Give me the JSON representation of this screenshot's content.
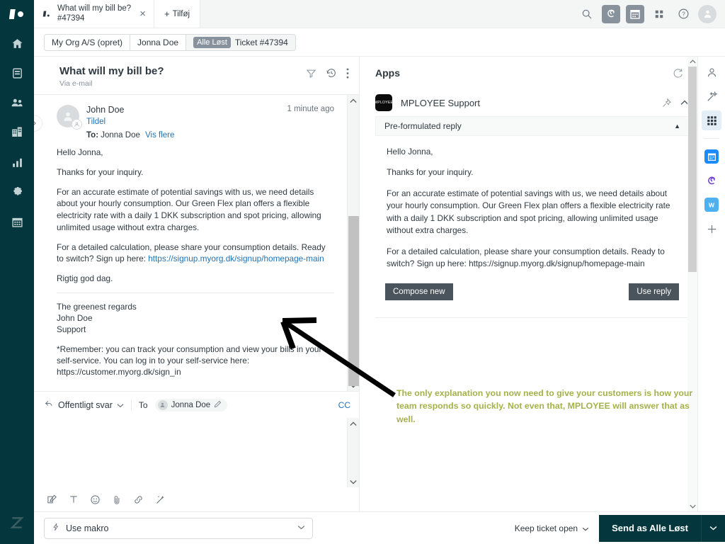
{
  "colors": {
    "brand_dark": "#03363d",
    "accent_link": "#1f73b7",
    "annotation": "#a5b14a",
    "badge_gray": "#87929d",
    "button_gray": "#49545c"
  },
  "leftnav": {
    "brand_icon": "zendesk-logo-icon",
    "items": [
      {
        "icon": "home-icon",
        "label": "Home"
      },
      {
        "icon": "views-icon",
        "label": "Views"
      },
      {
        "icon": "customers-icon",
        "label": "Customers"
      },
      {
        "icon": "organizations-icon",
        "label": "Organizations"
      },
      {
        "icon": "reporting-icon",
        "label": "Reporting"
      },
      {
        "icon": "admin-gear-icon",
        "label": "Admin"
      },
      {
        "icon": "calendar-icon",
        "label": "Calendar"
      }
    ],
    "bottom_logo": "zendesk-z-icon"
  },
  "topbar": {
    "tab": {
      "title": "What will my bill be?",
      "subtitle": "#47394",
      "close": "×",
      "icon": "ticket-icon"
    },
    "add_tab": {
      "plus": "+",
      "label": "Tilføj"
    },
    "icons": [
      {
        "name": "search-icon"
      },
      {
        "name": "spiral-app-icon"
      },
      {
        "name": "calendar-app-icon"
      },
      {
        "name": "products-grid-icon"
      },
      {
        "name": "help-icon"
      },
      {
        "name": "user-avatar-icon"
      }
    ]
  },
  "breadcrumb": {
    "items": [
      {
        "label": "My Org A/S (opret)",
        "badge": ""
      },
      {
        "label": "Jonna Doe",
        "badge": ""
      },
      {
        "label": "Ticket #47394",
        "badge": "Alle Løst"
      }
    ]
  },
  "ticket": {
    "title": "What will my bill be?",
    "via": "Via e-mail",
    "actions": [
      {
        "name": "filter-icon"
      },
      {
        "name": "history-icon"
      },
      {
        "name": "more-options-icon"
      }
    ],
    "message": {
      "author": "John Doe",
      "assign_link": "Tildel",
      "to_label": "To:",
      "to_value": "Jonna Doe",
      "show_more": "Vis flere",
      "timestamp": "1 minute ago",
      "greeting": "Hello Jonna,",
      "thanks": "Thanks for your inquiry.",
      "paragraph1": "For an accurate estimate of potential savings with us, we need details about your hourly consumption. Our Green Flex plan offers a flexible electricity rate with a daily 1 DKK subscription and spot pricing, allowing unlimited usage without extra charges.",
      "paragraph2_pre": "For a detailed calculation, please share your consumption details. Ready to switch? Sign up here: ",
      "paragraph2_link": "https://signup.myorg.dk/signup/homepage-main",
      "closing": "Rigtig god dag.",
      "sign_line1": "The greenest regards",
      "sign_line2": "John Doe",
      "sign_line3": "Support",
      "footnote": "*Remember: you can track your consumption and view your bills in your self-service. You can log in to your self-service here: https://customer.myorg.dk/sign_in"
    }
  },
  "composer": {
    "channel": "Offentligt svar",
    "to_label": "To",
    "recipient": "Jonna Doe",
    "cc_label": "CC",
    "tools": [
      {
        "name": "compose-icon"
      },
      {
        "name": "text-format-icon"
      },
      {
        "name": "emoji-icon"
      },
      {
        "name": "attachment-icon"
      },
      {
        "name": "link-icon"
      },
      {
        "name": "magic-wand-icon"
      }
    ]
  },
  "apps": {
    "title": "Apps",
    "refresh_icon": "refresh-icon",
    "card": {
      "icon_text": "MPLOYEE",
      "name": "MPLOYEE Support",
      "pin_icon": "pin-icon",
      "collapse_icon": "chevron-up-icon",
      "section_title": "Pre-formulated reply",
      "section_caret": "▲",
      "reply": {
        "greeting": "Hello Jonna,",
        "thanks": "Thanks for your inquiry.",
        "paragraph1": "For an accurate estimate of potential savings with us, we need details about your hourly consumption. Our Green Flex plan offers a flexible electricity rate with a daily 1 DKK subscription and spot pricing, allowing unlimited usage without extra charges.",
        "paragraph2": "For a detailed calculation, please share your consumption details. Ready to switch? Sign up here: https://signup.myorg.dk/signup/homepage-main"
      },
      "compose_new_button": "Compose new",
      "use_reply_button": "Use reply"
    }
  },
  "annotation": {
    "text": "The only explanation you now need to give your customers is how your team responds so quickly. Not even that, MPLOYEE will answer that as well."
  },
  "rail": {
    "items": [
      {
        "name": "user-profile-icon",
        "selected": false
      },
      {
        "name": "magic-wand-icon",
        "selected": false
      },
      {
        "name": "apps-grid-icon",
        "selected": true
      },
      {
        "name": "calendar-blue-icon",
        "selected": false
      },
      {
        "name": "spiral-purple-icon",
        "selected": false
      },
      {
        "name": "word-w-icon",
        "selected": false
      },
      {
        "name": "add-plus-icon",
        "selected": false
      }
    ]
  },
  "bottombar": {
    "macro_placeholder": "Use makro",
    "macro_icon": "lightning-icon",
    "keep_ticket_open": "Keep ticket open",
    "send_button": "Send as Alle Løst",
    "send_caret": "⌄"
  }
}
